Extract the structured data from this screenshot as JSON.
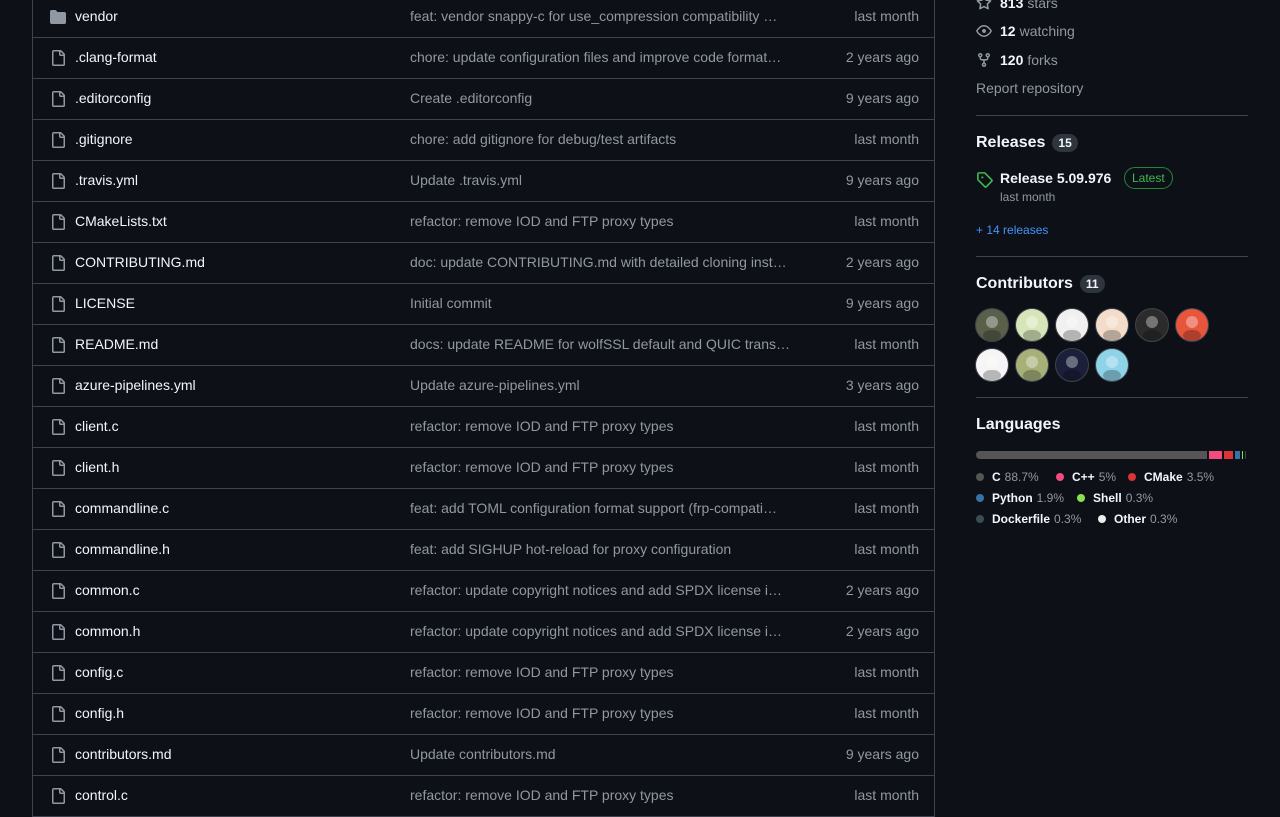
{
  "files": [
    {
      "type": "folder",
      "name": "vendor",
      "message": "feat: vendor snappy-c for use_compression compatibility …",
      "date": "last month"
    },
    {
      "type": "file",
      "name": ".clang-format",
      "message": "chore: update configuration files and improve code format…",
      "date": "2 years ago"
    },
    {
      "type": "file",
      "name": ".editorconfig",
      "message": "Create .editorconfig",
      "date": "9 years ago"
    },
    {
      "type": "file",
      "name": ".gitignore",
      "message": "chore: add gitignore for debug/test artifacts",
      "date": "last month"
    },
    {
      "type": "file",
      "name": ".travis.yml",
      "message": "Update .travis.yml",
      "date": "9 years ago"
    },
    {
      "type": "file",
      "name": "CMakeLists.txt",
      "message": "refactor: remove IOD and FTP proxy types",
      "date": "last month"
    },
    {
      "type": "file",
      "name": "CONTRIBUTING.md",
      "message": "doc: update CONTRIBUTING.md with detailed cloning inst…",
      "date": "2 years ago"
    },
    {
      "type": "file",
      "name": "LICENSE",
      "message": "Initial commit",
      "date": "9 years ago"
    },
    {
      "type": "file",
      "name": "README.md",
      "message": "docs: update README for wolfSSL default and QUIC trans…",
      "date": "last month"
    },
    {
      "type": "file",
      "name": "azure-pipelines.yml",
      "message": "Update azure-pipelines.yml",
      "date": "3 years ago"
    },
    {
      "type": "file",
      "name": "client.c",
      "message": "refactor: remove IOD and FTP proxy types",
      "date": "last month"
    },
    {
      "type": "file",
      "name": "client.h",
      "message": "refactor: remove IOD and FTP proxy types",
      "date": "last month"
    },
    {
      "type": "file",
      "name": "commandline.c",
      "message": "feat: add TOML configuration format support (frp-compati…",
      "date": "last month"
    },
    {
      "type": "file",
      "name": "commandline.h",
      "message": "feat: add SIGHUP hot-reload for proxy configuration",
      "date": "last month"
    },
    {
      "type": "file",
      "name": "common.c",
      "message": "refactor: update copyright notices and add SPDX license i…",
      "date": "2 years ago"
    },
    {
      "type": "file",
      "name": "common.h",
      "message": "refactor: update copyright notices and add SPDX license i…",
      "date": "2 years ago"
    },
    {
      "type": "file",
      "name": "config.c",
      "message": "refactor: remove IOD and FTP proxy types",
      "date": "last month"
    },
    {
      "type": "file",
      "name": "config.h",
      "message": "refactor: remove IOD and FTP proxy types",
      "date": "last month"
    },
    {
      "type": "file",
      "name": "contributors.md",
      "message": "Update contributors.md",
      "date": "9 years ago"
    },
    {
      "type": "file",
      "name": "control.c",
      "message": "refactor: remove IOD and FTP proxy types",
      "date": "last month"
    }
  ],
  "about": {
    "stars_count": "813",
    "stars_label": "stars",
    "watching_count": "12",
    "watching_label": "watching",
    "forks_count": "120",
    "forks_label": "forks",
    "report": "Report repository"
  },
  "releases": {
    "title": "Releases",
    "count": "15",
    "latest_name": "Release 5.09.976",
    "latest_badge": "Latest",
    "latest_date": "last month",
    "more": "+ 14 releases"
  },
  "contributors": {
    "title": "Contributors",
    "count": "11",
    "avatars": [
      {
        "name": "avatar-1",
        "bg": "#5a5f4a"
      },
      {
        "name": "avatar-2",
        "bg": "#d7e6b8"
      },
      {
        "name": "avatar-3",
        "bg": "#f0f0f0"
      },
      {
        "name": "avatar-4",
        "bg": "#f3dcc9"
      },
      {
        "name": "avatar-5",
        "bg": "#2b2b2b"
      },
      {
        "name": "avatar-6",
        "bg": "#e8553c"
      },
      {
        "name": "avatar-7",
        "bg": "#f5f5f5"
      },
      {
        "name": "avatar-8",
        "bg": "#a8b07a"
      },
      {
        "name": "avatar-9",
        "bg": "#1b1f3a"
      },
      {
        "name": "avatar-10",
        "bg": "#8fd3e8"
      }
    ]
  },
  "languages": {
    "title": "Languages",
    "items": [
      {
        "name": "C",
        "pct": "88.7%",
        "value": 88.7,
        "color": "#555555"
      },
      {
        "name": "C++",
        "pct": "5%",
        "value": 5,
        "color": "#f34b7d"
      },
      {
        "name": "CMake",
        "pct": "3.5%",
        "value": 3.5,
        "color": "#DA3434"
      },
      {
        "name": "Python",
        "pct": "1.9%",
        "value": 1.9,
        "color": "#3572A5"
      },
      {
        "name": "Shell",
        "pct": "0.3%",
        "value": 0.3,
        "color": "#89e051"
      },
      {
        "name": "Dockerfile",
        "pct": "0.3%",
        "value": 0.3,
        "color": "#384d54"
      },
      {
        "name": "Other",
        "pct": "0.3%",
        "value": 0.3,
        "color": "#ededed"
      }
    ]
  }
}
